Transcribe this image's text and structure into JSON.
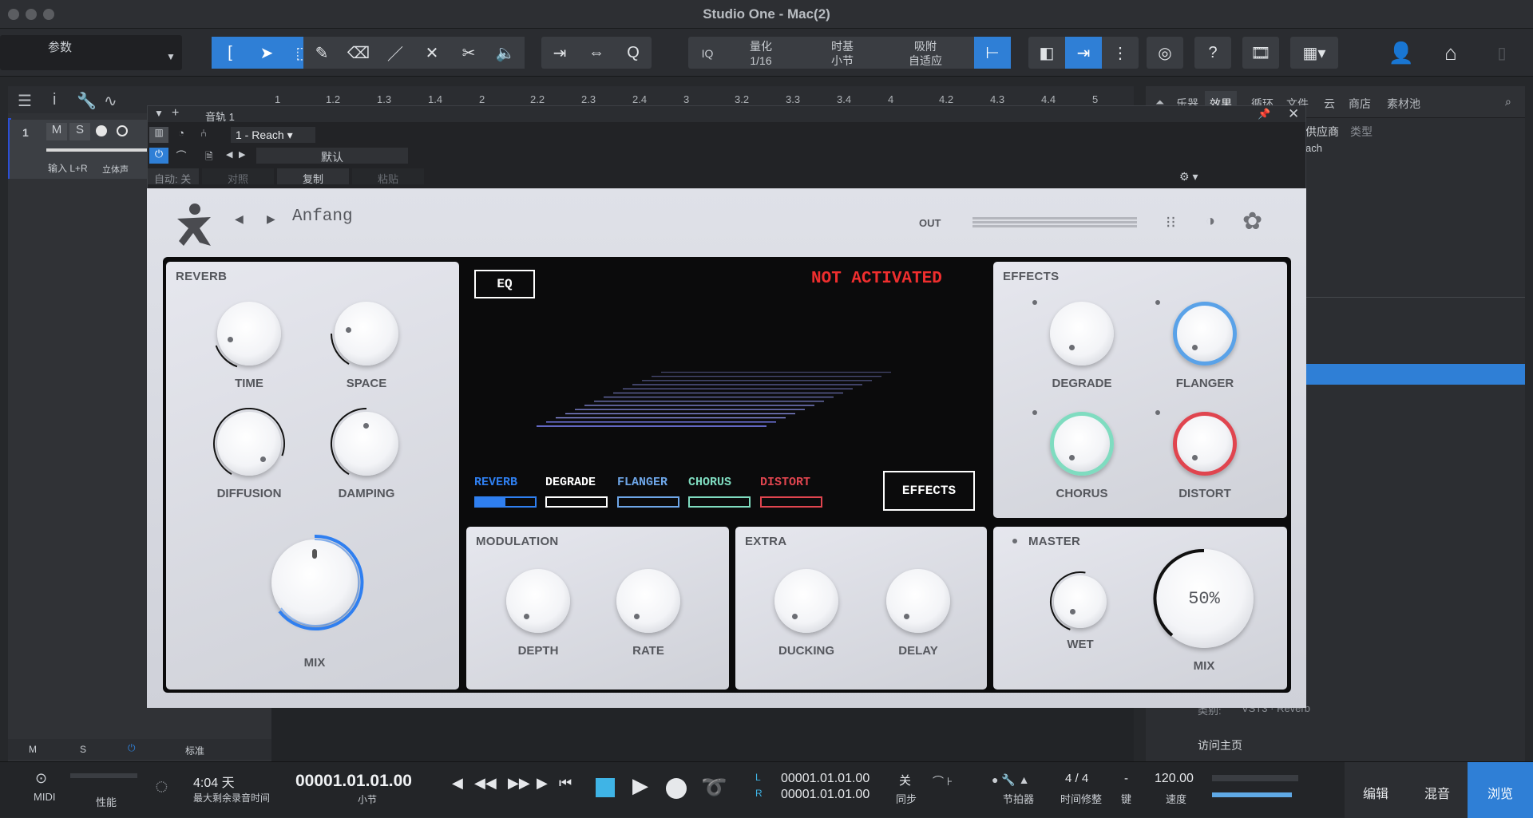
{
  "window": {
    "title": "Studio One - Mac(2)"
  },
  "toolbar": {
    "param_label": "参数",
    "quant_label": "量化",
    "quant_value": "1/16",
    "timebase_label": "时基",
    "timebase_value": "小节",
    "snap_label": "吸附",
    "snap_value": "自适应",
    "iq": "IQ",
    "help": "?"
  },
  "ruler": {
    "marks": [
      "1",
      "1.2",
      "1.3",
      "1.4",
      "2",
      "2.2",
      "2.3",
      "2.4",
      "3",
      "3.2",
      "3.3",
      "3.4",
      "4",
      "4.2",
      "4.3",
      "4.4",
      "5"
    ]
  },
  "track": {
    "number": "1",
    "mute": "M",
    "solo": "S",
    "input": "输入 L+R",
    "mode": "立体声"
  },
  "left_bottom": {
    "m": "M",
    "s": "S",
    "mode": "标准"
  },
  "browser": {
    "tabs": [
      "乐器",
      "效果",
      "循环",
      "文件",
      "云",
      "商店",
      "素材池"
    ],
    "sub_vendor": "供应商",
    "sub_type": "类型",
    "item": "ach",
    "category_label": "类别:",
    "category_value": "VST3 · Reverb",
    "home_link": "访问主页"
  },
  "plugin_window": {
    "track_name": "音轨 1",
    "preset_slot": "1 - Reach",
    "preset_name": "默认",
    "auto": "自动: 关",
    "compare": "对照",
    "copy": "复制",
    "paste": "粘贴"
  },
  "plugin": {
    "preset": "Anfang",
    "out_label": "OUT",
    "eq_button": "EQ",
    "not_activated": "NOT ACTIVATED",
    "effects_button": "EFFECTS",
    "reverb": {
      "title": "REVERB",
      "knobs": [
        "TIME",
        "SPACE",
        "DIFFUSION",
        "DAMPING"
      ],
      "mix": "MIX"
    },
    "effects": {
      "title": "EFFECTS",
      "knobs": [
        "DEGRADE",
        "FLANGER",
        "CHORUS",
        "DISTORT"
      ]
    },
    "tabs": [
      {
        "label": "REVERB",
        "color": "#2f7ff0"
      },
      {
        "label": "DEGRADE",
        "color": "#ffffff"
      },
      {
        "label": "FLANGER",
        "color": "#6ea6e8"
      },
      {
        "label": "CHORUS",
        "color": "#7fdcc0"
      },
      {
        "label": "DISTORT",
        "color": "#e0454f"
      }
    ],
    "modulation": {
      "title": "MODULATION",
      "knobs": [
        "DEPTH",
        "RATE"
      ]
    },
    "extra": {
      "title": "EXTRA",
      "knobs": [
        "DUCKING",
        "DELAY"
      ]
    },
    "master": {
      "title": "MASTER",
      "wet": "WET",
      "mix": "MIX",
      "mix_value": "50%"
    }
  },
  "status": {
    "midi": "MIDI",
    "perf": "性能",
    "time_remaining": "4:04 天",
    "remaining_label": "最大剩余录音时间",
    "position": "00001.01.01.00",
    "pos_unit": "小节",
    "L": "L",
    "R": "R",
    "loop_start": "00001.01.01.00",
    "loop_end": "00001.01.01.00",
    "sync": "关",
    "sync_label": "同步",
    "metronome": "节拍器",
    "signature": "4 / 4",
    "timecorr": "时间修整",
    "key": "-",
    "key_label": "键",
    "tempo": "120.00",
    "tempo_label": "速度",
    "edit": "编辑",
    "mix": "混音",
    "browse": "浏览"
  }
}
